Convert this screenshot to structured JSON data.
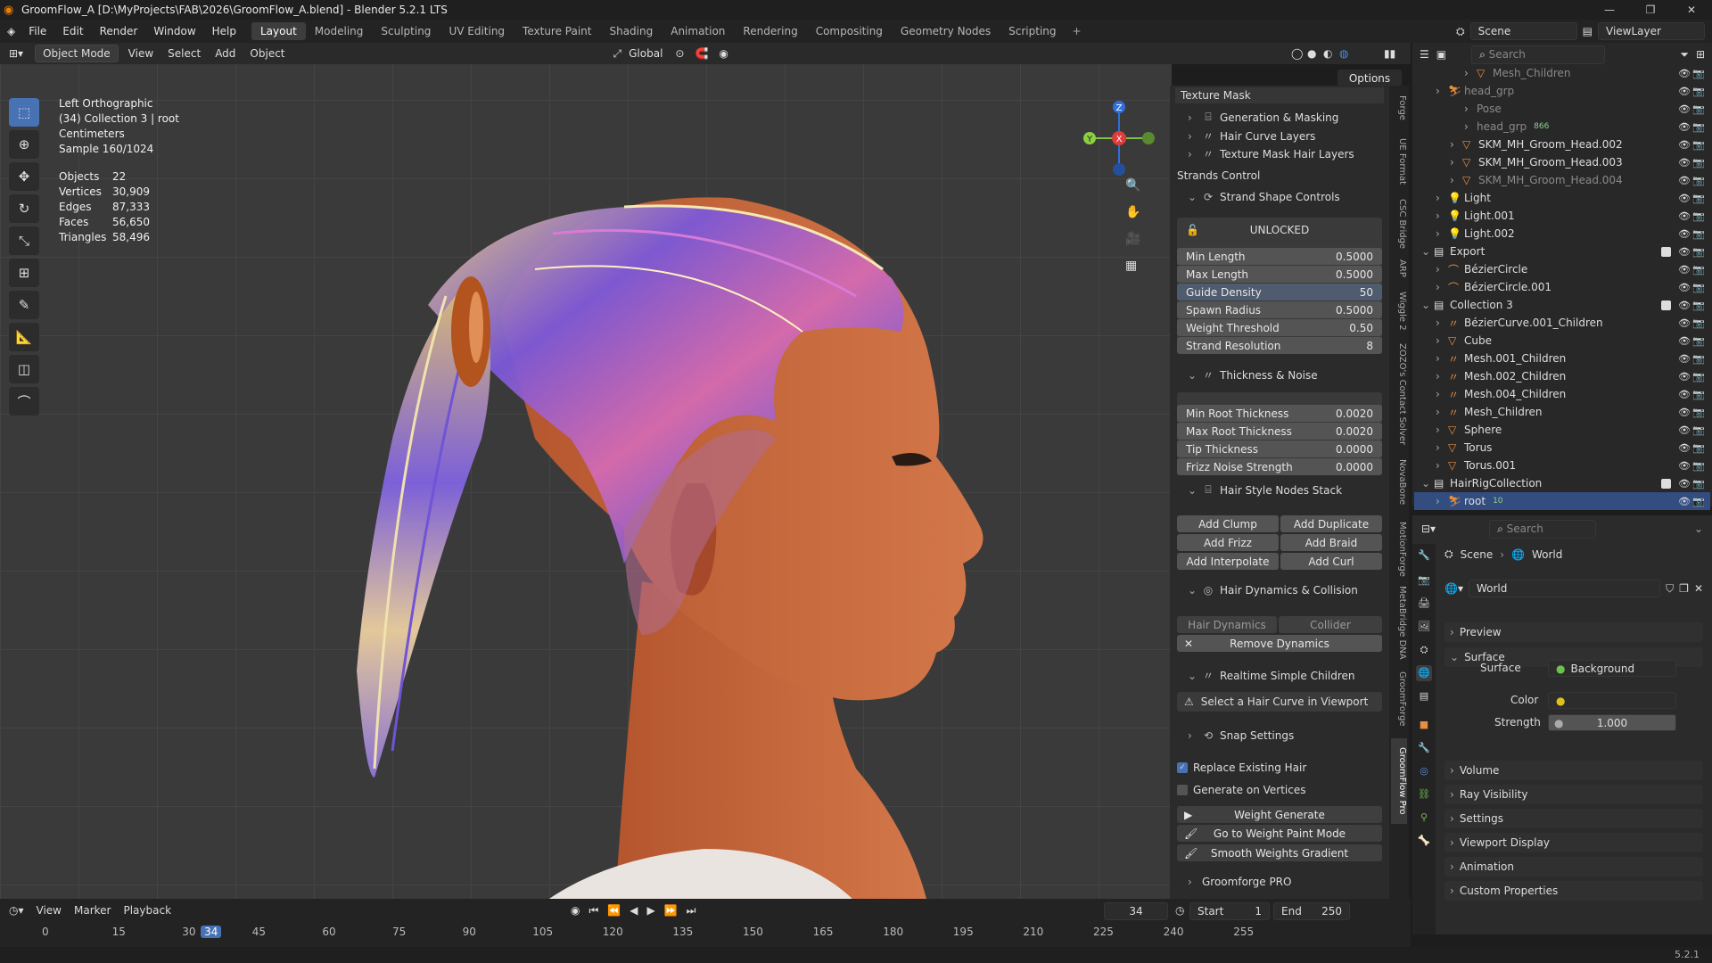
{
  "window": {
    "title": "GroomFlow_A [D:\\MyProjects\\FAB\\2026\\GroomFlow_A.blend] - Blender 5.2.1 LTS",
    "minimize": "—",
    "maximize": "❐",
    "close": "✕"
  },
  "menu": {
    "items": [
      "File",
      "Edit",
      "Render",
      "Window",
      "Help"
    ],
    "workspaces": [
      "Layout",
      "Modeling",
      "Sculpting",
      "UV Editing",
      "Texture Paint",
      "Shading",
      "Animation",
      "Rendering",
      "Compositing",
      "Geometry Nodes",
      "Scripting"
    ],
    "active_workspace": "Layout",
    "add_ws": "+",
    "scene": "Scene",
    "view_layer": "ViewLayer"
  },
  "viewport_header": {
    "mode": "Object Mode",
    "items": [
      "View",
      "Select",
      "Add",
      "Object"
    ],
    "transform": "Global",
    "options": "Options"
  },
  "overlay_info": {
    "view": "Left Orthographic",
    "collection": "(34) Collection 3 | root",
    "units": "Centimeters",
    "sample": "Sample 160/1024"
  },
  "stats": [
    {
      "k": "Objects",
      "v": "22"
    },
    {
      "k": "Vertices",
      "v": "30,909"
    },
    {
      "k": "Edges",
      "v": "87,333"
    },
    {
      "k": "Faces",
      "v": "56,650"
    },
    {
      "k": "Triangles",
      "v": "58,496"
    }
  ],
  "npanel": {
    "texture_mask": "Texture Mask",
    "tm_items": [
      "Generation & Masking",
      "Hair Curve Layers",
      "Texture Mask Hair Layers"
    ],
    "strands_control": "Strands Control",
    "strand_shape": "Strand Shape Controls",
    "unlocked": "UNLOCKED",
    "props1": [
      {
        "k": "Min Length",
        "v": "0.5000"
      },
      {
        "k": "Max Length",
        "v": "0.5000"
      },
      {
        "k": "Guide Density",
        "v": "50"
      },
      {
        "k": "Spawn Radius",
        "v": "0.5000"
      },
      {
        "k": "Weight Threshold",
        "v": "0.50"
      },
      {
        "k": "Strand Resolution",
        "v": "8"
      }
    ],
    "thickness": "Thickness & Noise",
    "props2": [
      {
        "k": "Min Root Thickness",
        "v": "0.0020"
      },
      {
        "k": "Max Root Thickness",
        "v": "0.0020"
      },
      {
        "k": "Tip Thickness",
        "v": "0.0000"
      },
      {
        "k": "Frizz Noise Strength",
        "v": "0.0000"
      }
    ],
    "stack": "Hair Style Nodes Stack",
    "stack_btns": [
      "Add Clump",
      "Add Duplicate",
      "Add Frizz",
      "Add Braid",
      "Add Interpolate",
      "Add Curl"
    ],
    "dynamics": "Hair Dynamics & Collision",
    "hair_dynamics": "Hair Dynamics",
    "collider": "Collider",
    "remove_dynamics": "Remove Dynamics",
    "realtime": "Realtime Simple Children",
    "select_curve": "Select a Hair Curve in Viewport",
    "snap": "Snap Settings",
    "replace": "Replace Existing Hair",
    "gen_vertices": "Generate on Vertices",
    "weight_generate": "Weight Generate",
    "weight_paint": "Go to Weight Paint Mode",
    "smooth_weights": "Smooth Weights Gradient",
    "groomforge": "Groomforge PRO"
  },
  "sidetabs": [
    "Forge",
    "UE Format",
    "CSC Bridge",
    "ARP",
    "Wiggle 2",
    "ZOZO's Contact Solver",
    "NovaBone",
    "MotionForge",
    "MetaBridge DNA",
    "GroomForge",
    "GroomFlow Pro"
  ],
  "outliner": {
    "search": "Search",
    "rows": [
      {
        "name": "Mesh_Children",
        "indent": 4,
        "dim": true,
        "icon": "tri"
      },
      {
        "name": "head_grp",
        "indent": 2,
        "dim": true,
        "icon": "arm"
      },
      {
        "name": "Pose",
        "indent": 4,
        "dim": true,
        "icon": ""
      },
      {
        "name": "head_grp",
        "indent": 4,
        "dim": true,
        "icon": "",
        "badge": "866"
      },
      {
        "name": "SKM_MH_Groom_Head.002",
        "indent": 3,
        "icon": "tri"
      },
      {
        "name": "SKM_MH_Groom_Head.003",
        "indent": 3,
        "icon": "tri"
      },
      {
        "name": "SKM_MH_Groom_Head.004",
        "indent": 3,
        "dim": true,
        "icon": "tri"
      },
      {
        "name": "Light",
        "indent": 2,
        "icon": "light"
      },
      {
        "name": "Light.001",
        "indent": 2,
        "icon": "light"
      },
      {
        "name": "Light.002",
        "indent": 2,
        "icon": "light"
      },
      {
        "name": "Export",
        "indent": 1,
        "icon": "col",
        "check": true
      },
      {
        "name": "BézierCircle",
        "indent": 2,
        "icon": "curve"
      },
      {
        "name": "BézierCircle.001",
        "indent": 2,
        "icon": "curve"
      },
      {
        "name": "Collection 3",
        "indent": 1,
        "icon": "col",
        "check": true
      },
      {
        "name": "BézierCurve.001_Children",
        "indent": 2,
        "icon": "hair"
      },
      {
        "name": "Cube",
        "indent": 2,
        "icon": "tri"
      },
      {
        "name": "Mesh.001_Children",
        "indent": 2,
        "icon": "hair"
      },
      {
        "name": "Mesh.002_Children",
        "indent": 2,
        "icon": "hair"
      },
      {
        "name": "Mesh.004_Children",
        "indent": 2,
        "icon": "hair"
      },
      {
        "name": "Mesh_Children",
        "indent": 2,
        "icon": "hair"
      },
      {
        "name": "Sphere",
        "indent": 2,
        "icon": "tri"
      },
      {
        "name": "Torus",
        "indent": 2,
        "icon": "tri"
      },
      {
        "name": "Torus.001",
        "indent": 2,
        "icon": "tri"
      },
      {
        "name": "HairRigCollection",
        "indent": 1,
        "icon": "col",
        "check": true
      },
      {
        "name": "root",
        "indent": 2,
        "icon": "arm",
        "sel": true,
        "badge": "10"
      }
    ]
  },
  "properties": {
    "search": "Search",
    "crumb_scene": "Scene",
    "crumb_world": "World",
    "world_name": "World",
    "sections": [
      "Preview",
      "Surface",
      "Volume",
      "Ray Visibility",
      "Settings",
      "Viewport Display",
      "Animation",
      "Custom Properties"
    ],
    "surface_label": "Surface",
    "surface_value": "Background",
    "color_label": "Color",
    "strength_label": "Strength",
    "strength_value": "1.000"
  },
  "timeline": {
    "items": [
      "View",
      "Marker",
      "Playback"
    ],
    "current": "34",
    "start_label": "Start",
    "start": "1",
    "end_label": "End",
    "end": "250",
    "ticks": [
      "0",
      "15",
      "30",
      "34",
      "45",
      "60",
      "75",
      "90",
      "105",
      "120",
      "135",
      "150",
      "165",
      "180",
      "195",
      "210",
      "225",
      "240",
      "255"
    ]
  },
  "status": {
    "version": "5.2.1"
  }
}
